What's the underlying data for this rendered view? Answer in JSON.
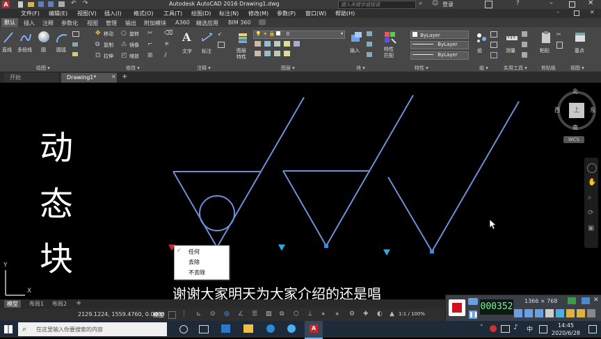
{
  "window": {
    "title": "Autodesk AutoCAD 2016    Drawing1.dwg",
    "search_placeholder": "键入关键字或短语",
    "login": "登录"
  },
  "menubar": [
    "文件(F)",
    "编辑(E)",
    "视图(V)",
    "插入(I)",
    "格式(O)",
    "工具(T)",
    "绘图(D)",
    "标注(N)",
    "修改(M)",
    "参数(P)",
    "窗口(W)",
    "帮助(H)"
  ],
  "ribbon_tabs": [
    "默认",
    "插入",
    "注释",
    "参数化",
    "视图",
    "管理",
    "输出",
    "附加模块",
    "A360",
    "精选应用",
    "BIM 360"
  ],
  "ribbon": {
    "draw": {
      "title": "绘图 ▾",
      "tools": [
        "直线",
        "多段线",
        "圆",
        "圆弧"
      ]
    },
    "modify": {
      "title": "修改 ▾",
      "tools": [
        "移动",
        "旋转",
        "复制",
        "镜像",
        "拉伸",
        "缩放"
      ]
    },
    "annotation": {
      "title": "注释 ▾",
      "tools": [
        "文字",
        "标注"
      ]
    },
    "layers": {
      "title": "图层 ▾",
      "tools": [
        "图层特性"
      ],
      "current_layer": "0"
    },
    "block": {
      "title": "块 ▾",
      "tools": [
        "插入"
      ]
    },
    "properties": {
      "title": "特性 ▾",
      "tools": [
        "特性匹配"
      ],
      "values": [
        "ByLayer",
        "ByLayer",
        "ByLayer"
      ]
    },
    "groups": {
      "title": "组 ▾",
      "tools": [
        "组"
      ]
    },
    "utilities": {
      "title": "实用工具 ▾",
      "tools": [
        "测量"
      ]
    },
    "clipboard": {
      "title": "剪贴板",
      "tools": [
        "粘贴"
      ]
    },
    "view": {
      "title": "视图 ▾",
      "tools": [
        "基点"
      ]
    }
  },
  "doc_tabs": [
    "开始",
    "Drawing1*"
  ],
  "canvas": {
    "caption_chars": [
      "动",
      "态",
      "块"
    ],
    "compass": {
      "north": "北",
      "south": "南",
      "east": "东",
      "west": "西",
      "center": "上",
      "wcs": "WCS"
    },
    "context_menu": [
      "任何",
      "去除",
      "不去除"
    ],
    "context_checked": "任何",
    "subtitle": "谢谢大家明天为大家介绍的还是唱",
    "ucs_y": "Y",
    "ucs_x": "X"
  },
  "layout_tabs": [
    "模型",
    "布局1",
    "布局2"
  ],
  "statusbar": {
    "coords": "2129.1224, 1559.4760, 0.0000",
    "model": "模型",
    "scale": "1:1 / 100%"
  },
  "recorder": {
    "timer": "000352",
    "resolution": "1366 × 768"
  },
  "taskbar": {
    "search_placeholder": "在这里输入你要搜索的内容",
    "time": "14:45",
    "date": "2020/6/28",
    "ime": "中"
  },
  "colors": {
    "drawing_line": "#6f8fd8",
    "grip": "#3a8ad8",
    "flip_grip": "#2fa8e0",
    "red_grip": "#c0303a"
  }
}
